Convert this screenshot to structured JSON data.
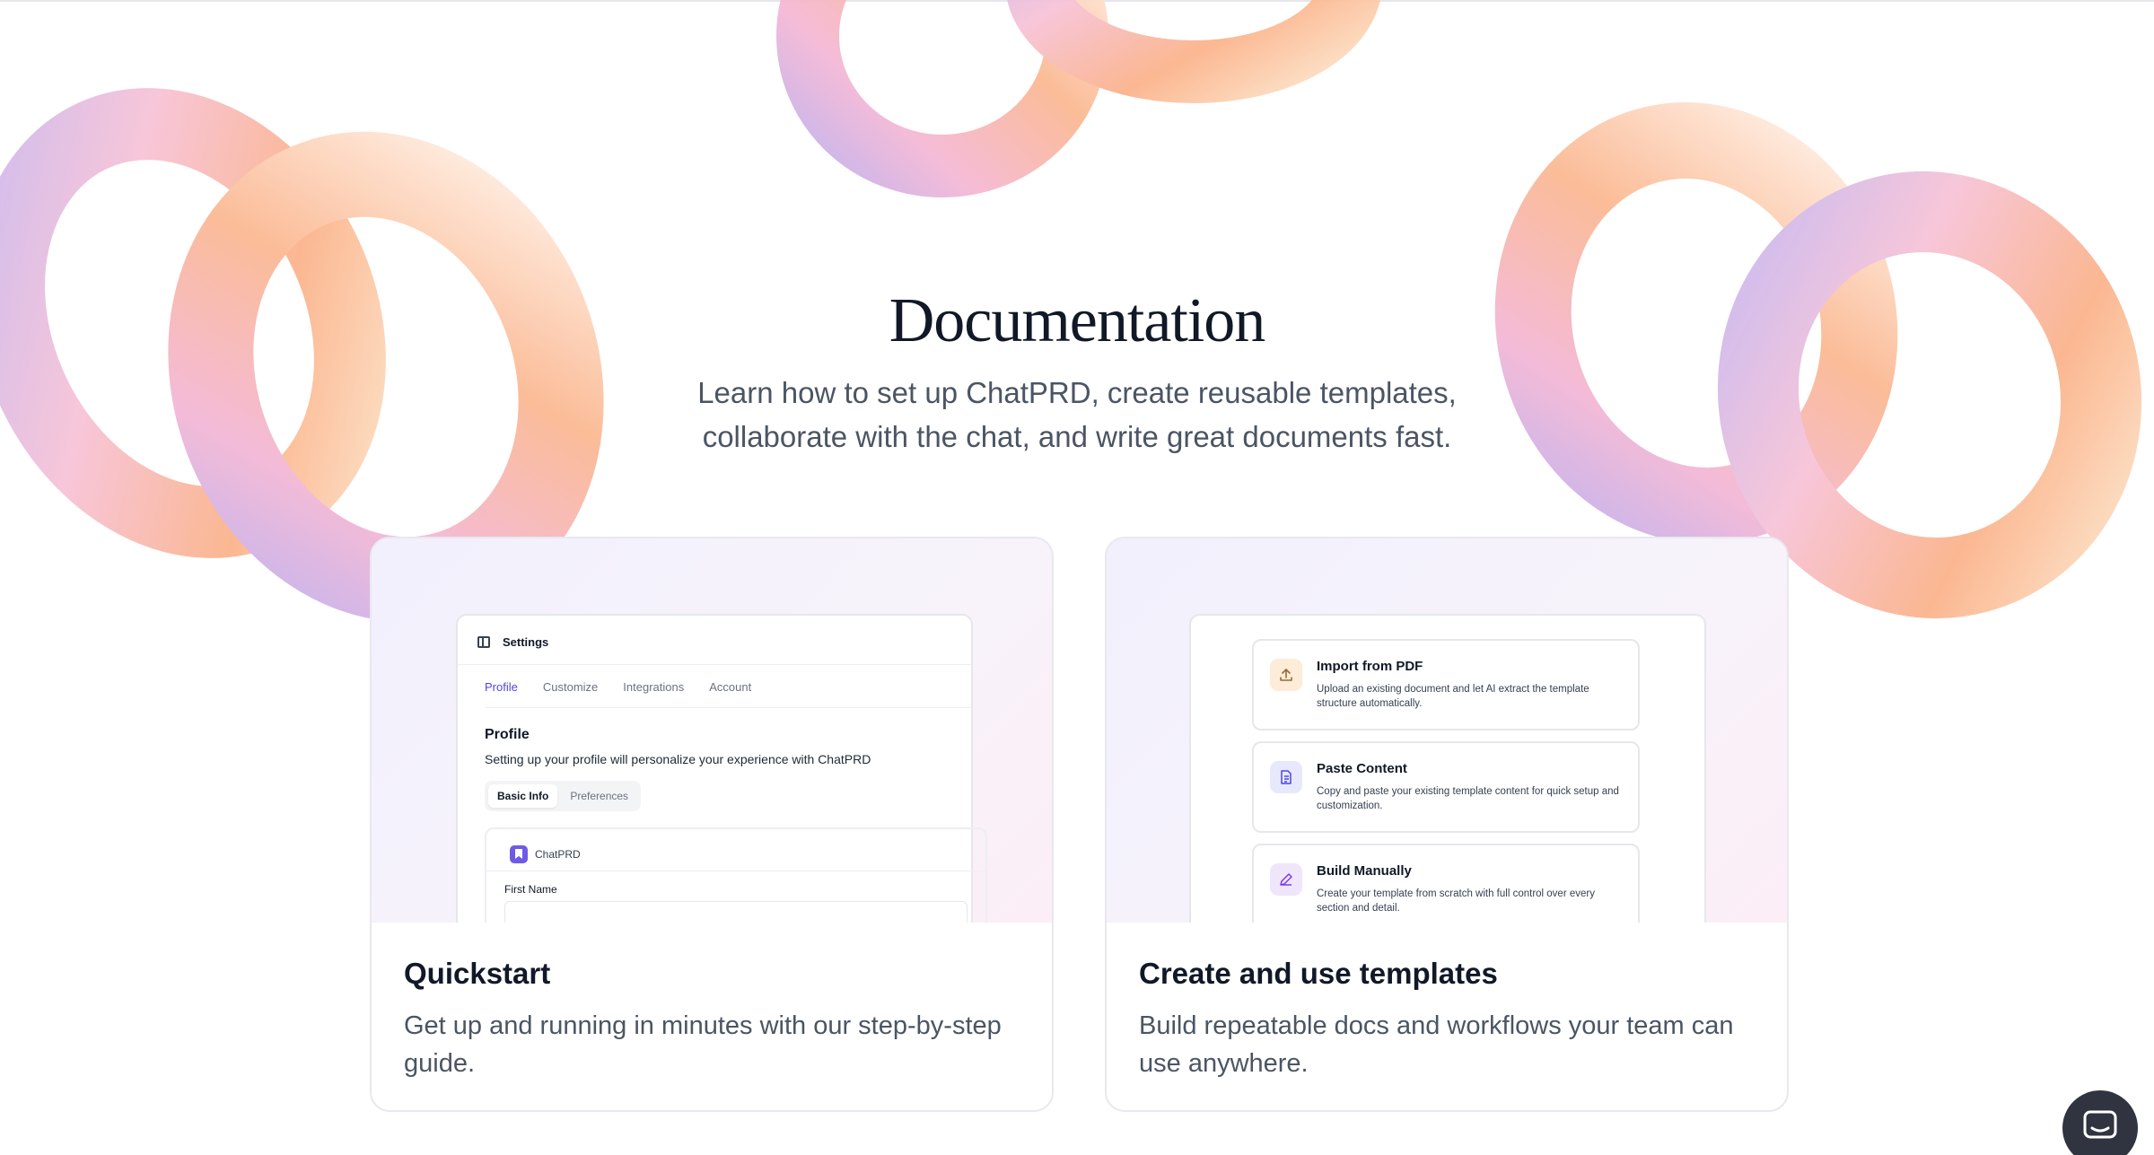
{
  "hero": {
    "title": "Documentation",
    "subtitle": "Learn how to set up ChatPRD, create reusable templates, collaborate with the chat, and write great documents fast."
  },
  "cards": [
    {
      "title": "Quickstart",
      "description": "Get up and running in minutes with our step-by-step guide.",
      "preview": {
        "header": "Settings",
        "tabs": [
          "Profile",
          "Customize",
          "Integrations",
          "Account"
        ],
        "active_tab": "Profile",
        "section_title": "Profile",
        "section_desc": "Setting up your profile will personalize your experience with ChatPRD",
        "segments": [
          "Basic Info",
          "Preferences"
        ],
        "brand": "ChatPRD",
        "field_label": "First Name"
      }
    },
    {
      "title": "Create and use templates",
      "description": "Build repeatable docs and workflows your team can use anywhere.",
      "preview": {
        "options": [
          {
            "title": "Import from PDF",
            "description": "Upload an existing document and let AI extract the template structure automatically.",
            "icon": "upload-icon"
          },
          {
            "title": "Paste Content",
            "description": "Copy and paste your existing template content for quick setup and customization.",
            "icon": "document-icon"
          },
          {
            "title": "Build Manually",
            "description": "Create your template from scratch with full control over every section and detail.",
            "icon": "pencil-icon"
          }
        ]
      }
    }
  ],
  "chat_widget": {
    "icon": "chat-icon"
  },
  "colors": {
    "accent": "#4f46e5",
    "brand": "#6d5ae6",
    "ribbon_peach": "#fbb98f",
    "ribbon_lilac": "#c7b8ee"
  }
}
